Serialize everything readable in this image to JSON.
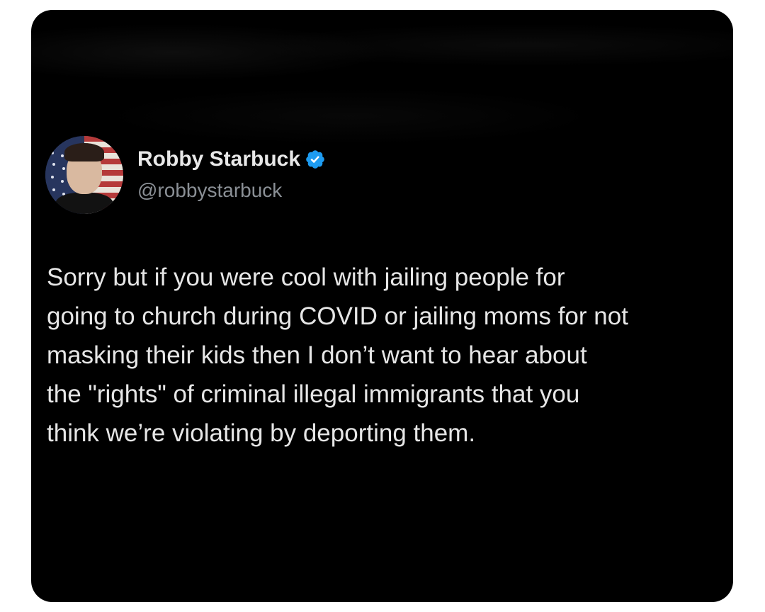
{
  "tweet": {
    "author": {
      "display_name": "Robby Starbuck",
      "handle": "@robbystarbuck",
      "verified": true,
      "avatar_icon": "profile-photo-flag-background"
    },
    "text": "Sorry but if you were cool with jailing people for\ngoing to church during COVID or jailing moms for not\nmasking their kids then I don’t want to hear about\nthe \"rights\" of criminal illegal immigrants that you\nthink we’re violating by deporting them."
  },
  "colors": {
    "background": "#000000",
    "page": "#ffffff",
    "name": "#e8e8e8",
    "handle": "#8a8f95",
    "text": "#e6e6e6",
    "verified_badge": "#1d9bf0"
  }
}
